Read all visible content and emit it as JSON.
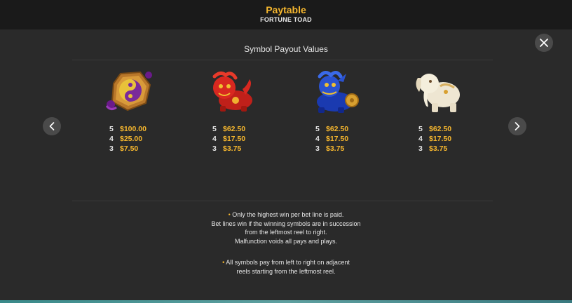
{
  "header": {
    "title": "Paytable",
    "subtitle": "FORTUNE TOAD"
  },
  "section": {
    "title": "Symbol Payout Values"
  },
  "symbols": [
    {
      "icon": "yin-yang-coin-icon",
      "payouts": [
        {
          "count": "5",
          "amount": "$100.00"
        },
        {
          "count": "4",
          "amount": "$25.00"
        },
        {
          "count": "3",
          "amount": "$7.50"
        }
      ]
    },
    {
      "icon": "red-lion-icon",
      "payouts": [
        {
          "count": "5",
          "amount": "$62.50"
        },
        {
          "count": "4",
          "amount": "$17.50"
        },
        {
          "count": "3",
          "amount": "$3.75"
        }
      ]
    },
    {
      "icon": "blue-dragon-icon",
      "payouts": [
        {
          "count": "5",
          "amount": "$62.50"
        },
        {
          "count": "4",
          "amount": "$17.50"
        },
        {
          "count": "3",
          "amount": "$3.75"
        }
      ]
    },
    {
      "icon": "white-elephant-icon",
      "payouts": [
        {
          "count": "5",
          "amount": "$62.50"
        },
        {
          "count": "4",
          "amount": "$17.50"
        },
        {
          "count": "3",
          "amount": "$3.75"
        }
      ]
    }
  ],
  "rules": {
    "bullet": "•",
    "rule1": [
      "Only the highest win per bet line is paid.",
      "Bet lines win if the winning symbols are in succession",
      "from the leftmost reel to right.",
      "Malfunction voids all pays and plays."
    ],
    "rule2": [
      "All symbols pay from left to right on adjacent",
      "reels starting from the leftmost reel."
    ]
  },
  "colors": {
    "accent": "#f6b72e",
    "background": "#2a2a2a",
    "header_background": "#1a1a1a"
  }
}
